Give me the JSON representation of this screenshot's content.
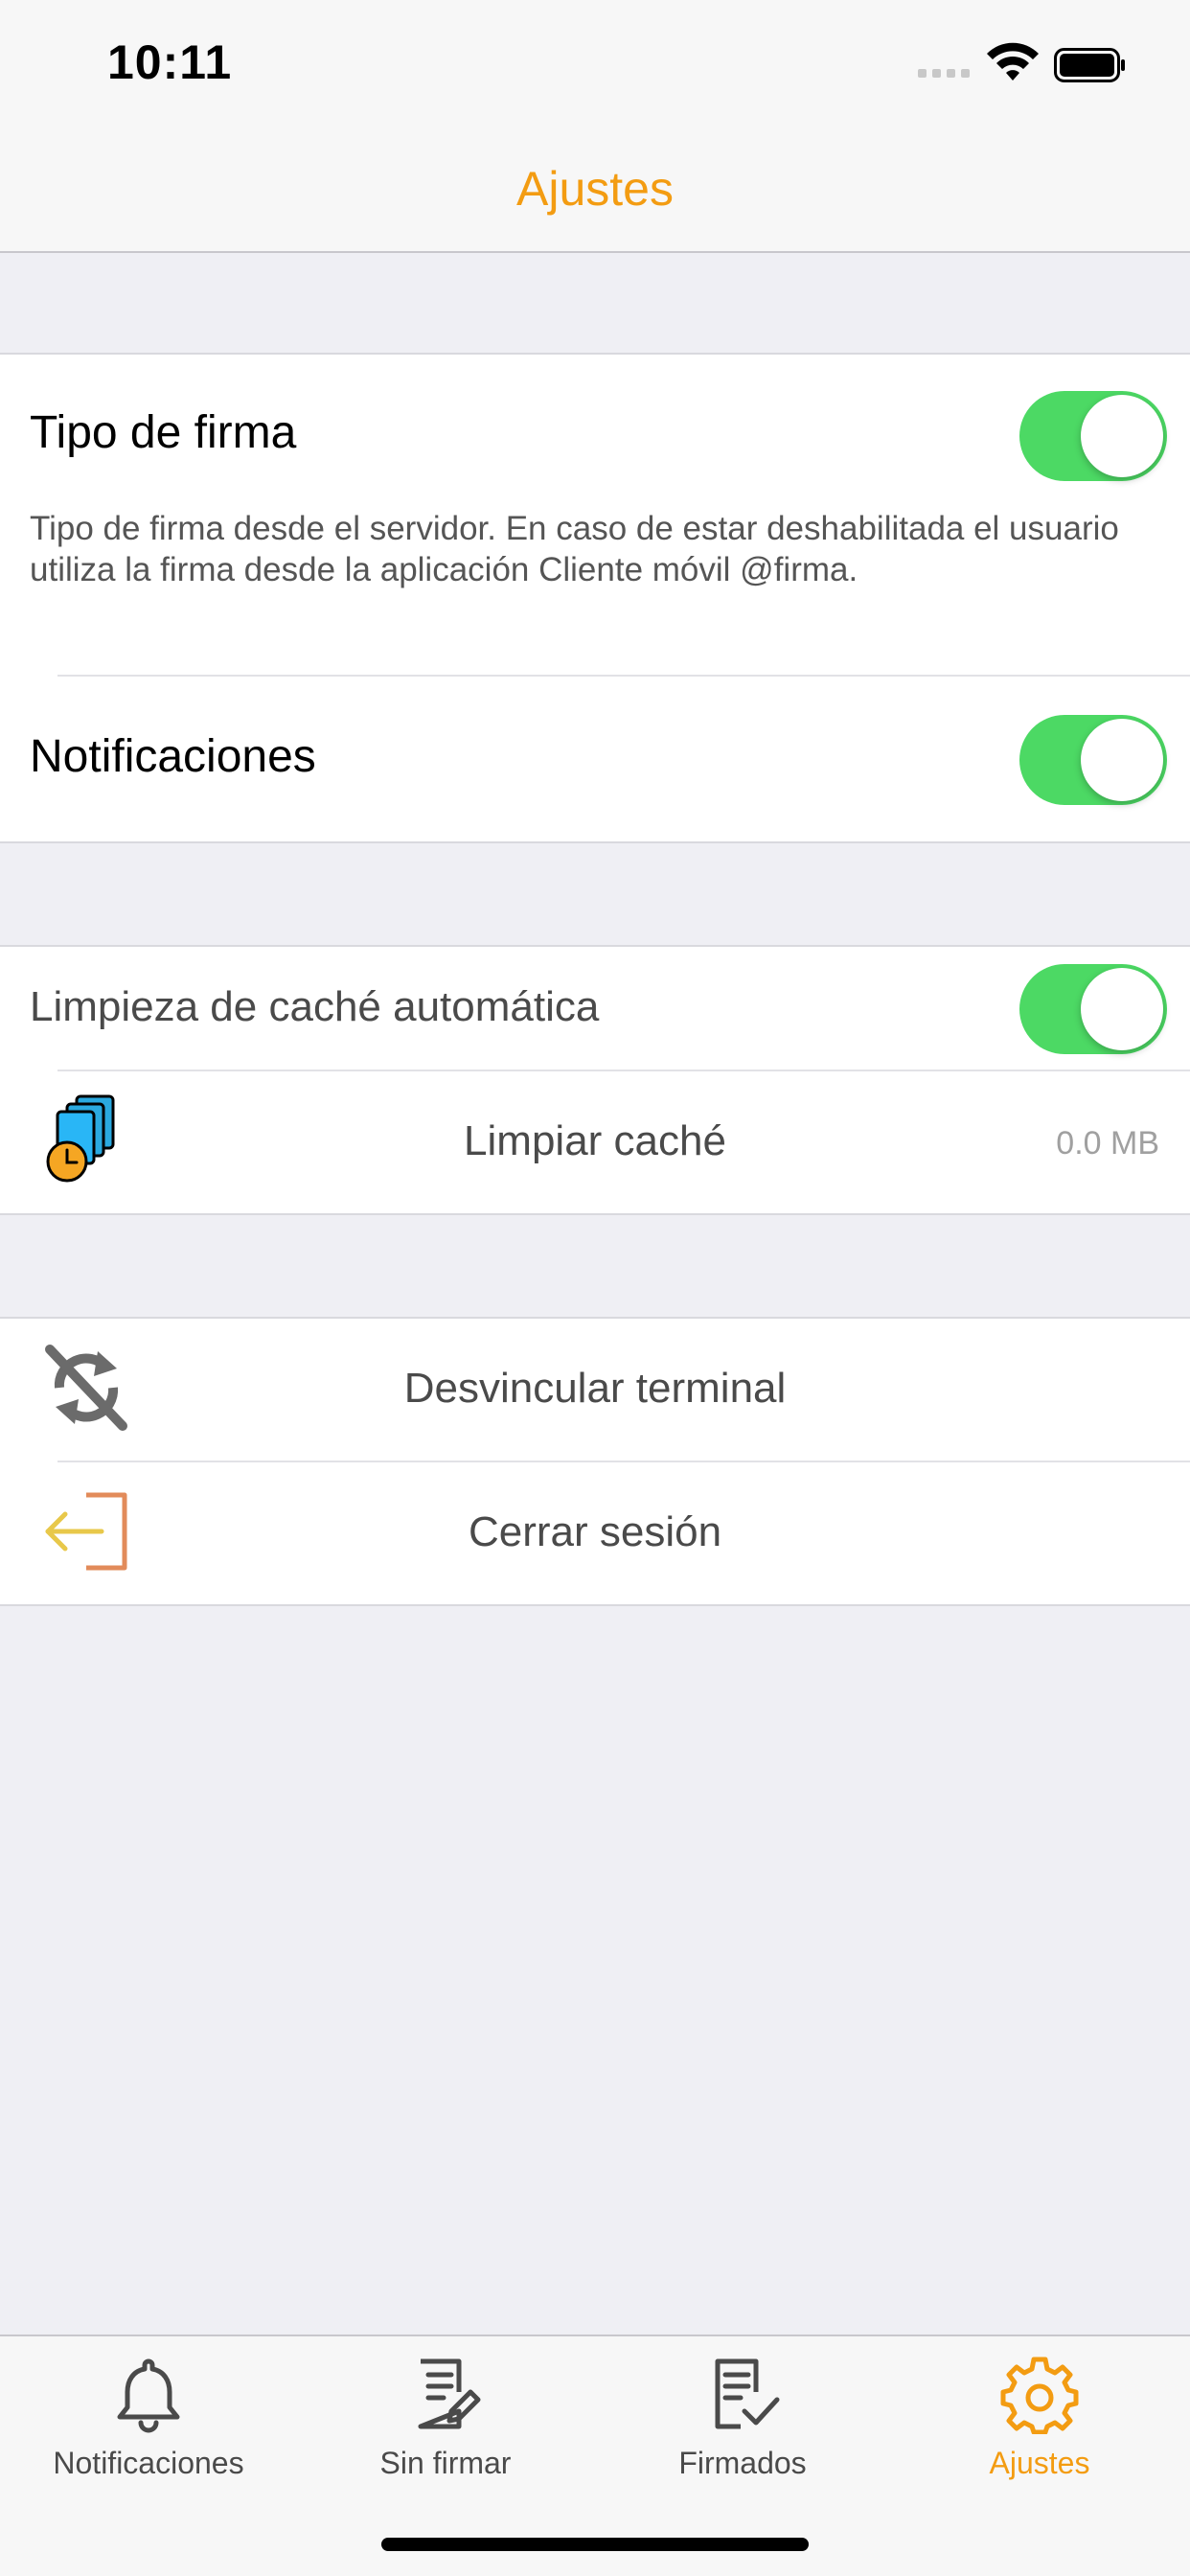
{
  "status_bar": {
    "time": "10:11"
  },
  "nav": {
    "title": "Ajustes"
  },
  "settings": {
    "tipo_firma": {
      "title": "Tipo de firma",
      "description": "Tipo de firma desde el servidor. En caso de estar deshabilitada el usuario utiliza la firma desde la aplicación Cliente móvil @firma.",
      "enabled": true
    },
    "notificaciones": {
      "title": "Notificaciones",
      "enabled": true
    },
    "limpieza_cache": {
      "title": "Limpieza de caché automática",
      "enabled": true
    },
    "limpiar_cache": {
      "label": "Limpiar caché",
      "size": "0.0 MB",
      "icon": "documents-clock-icon"
    },
    "desvincular": {
      "label": "Desvincular terminal",
      "icon": "sync-disabled-icon"
    },
    "cerrar_sesion": {
      "label": "Cerrar sesión",
      "icon": "logout-icon"
    }
  },
  "tabs": [
    {
      "label": "Notificaciones",
      "icon": "bell-icon",
      "active": false
    },
    {
      "label": "Sin firmar",
      "icon": "document-pen-icon",
      "active": false
    },
    {
      "label": "Firmados",
      "icon": "document-check-icon",
      "active": false
    },
    {
      "label": "Ajustes",
      "icon": "gear-icon",
      "active": true
    }
  ],
  "colors": {
    "accent": "#F39C12",
    "toggle_on": "#4CD964",
    "background": "#EFEFF4"
  }
}
